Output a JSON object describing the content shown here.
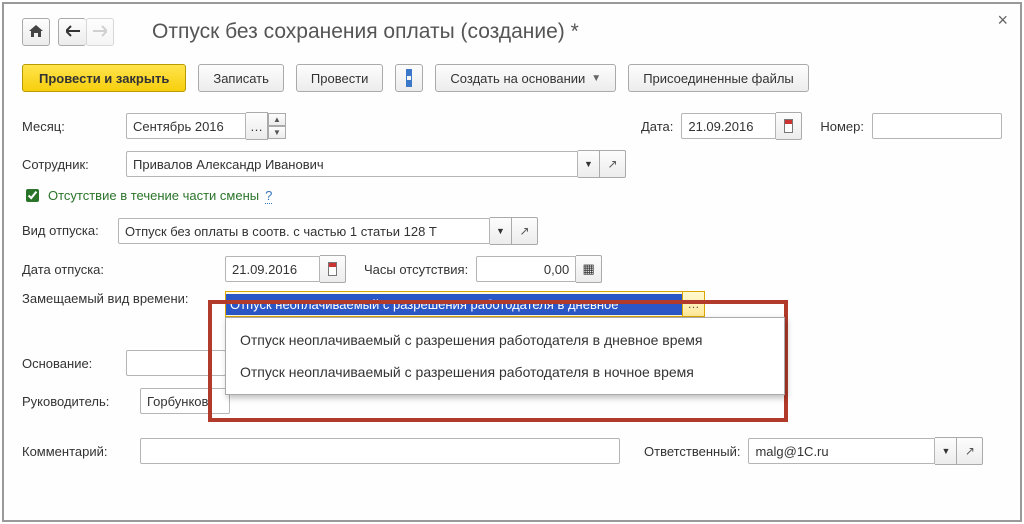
{
  "title": "Отпуск без сохранения оплаты (создание) *",
  "toolbar": {
    "save_close": "Провести и закрыть",
    "record": "Записать",
    "post": "Провести",
    "create_based": "Создать на основании",
    "attached_files": "Присоединенные файлы"
  },
  "labels": {
    "month": "Месяц:",
    "date": "Дата:",
    "number": "Номер:",
    "employee": "Сотрудник:",
    "absence_partial": "Отсутствие в течение части смены",
    "leave_type": "Вид отпуска:",
    "leave_date": "Дата отпуска:",
    "absence_hours": "Часы отсутствия:",
    "replaced_time_type": "Замещаемый вид времени:",
    "basis": "Основание:",
    "manager": "Руководитель:",
    "comment": "Комментарий:",
    "responsible": "Ответственный:",
    "help": "?"
  },
  "values": {
    "month": "Сентябрь 2016",
    "date": "21.09.2016",
    "number": "",
    "employee": "Привалов Александр Иванович",
    "leave_type": "Отпуск без оплаты в соотв. с частью 1 статьи 128 Т",
    "leave_date": "21.09.2016",
    "absence_hours": "0,00",
    "replaced_time_type_selected": "Отпуск неоплачиваемый с разрешения работодателя в дневное",
    "basis": "",
    "manager": "Горбунков",
    "comment": "",
    "responsible": "malg@1C.ru"
  },
  "dropdown_options": [
    "Отпуск неоплачиваемый с разрешения работодателя в дневное время",
    "Отпуск неоплачиваемый с разрешения работодателя в ночное время"
  ]
}
